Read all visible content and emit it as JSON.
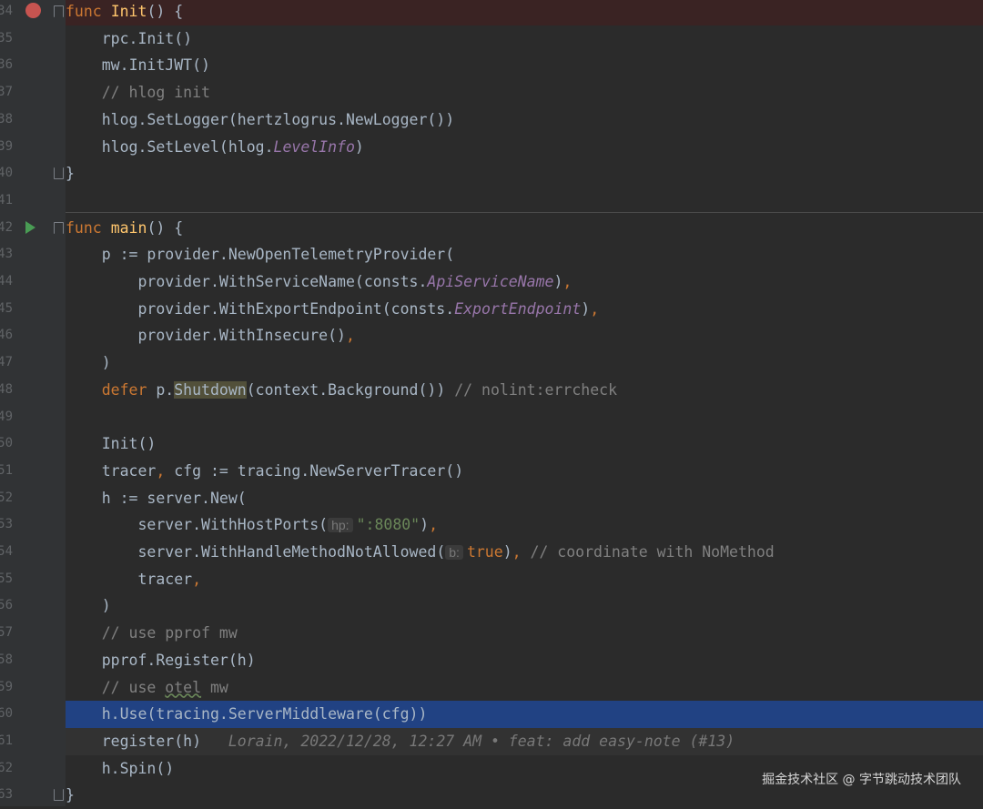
{
  "gutter": {
    "line_numbers": [
      "34",
      "35",
      "36",
      "37",
      "38",
      "39",
      "40",
      "41",
      "42",
      "43",
      "44",
      "45",
      "46",
      "47",
      "48",
      "49",
      "50",
      "51",
      "52",
      "53",
      "54",
      "55",
      "56",
      "57",
      "58",
      "59",
      "60",
      "61",
      "62",
      "63"
    ]
  },
  "code": {
    "l34": {
      "kw": "func",
      "name": "Init",
      "rest": "() {"
    },
    "l35": {
      "pkg": "rpc.",
      "fn": "Init",
      "rest": "()"
    },
    "l36": {
      "pkg": "mw.",
      "fn": "InitJWT",
      "rest": "()"
    },
    "l37": {
      "comment": "// hlog init"
    },
    "l38": {
      "pkg": "hlog.",
      "fn": "SetLogger",
      "rest1": "(hertzlogrus.",
      "fn2": "NewLogger",
      "rest2": "())"
    },
    "l39": {
      "pkg": "hlog.",
      "fn": "SetLevel",
      "rest1": "(hlog.",
      "const": "LevelInfo",
      "rest2": ")"
    },
    "l40": {
      "text": "}"
    },
    "l42": {
      "kw": "func",
      "name": "main",
      "rest": "() {"
    },
    "l43": {
      "pre": "p := provider.",
      "fn": "NewOpenTelemetryProvider",
      "rest": "("
    },
    "l44": {
      "pre": "provider.",
      "fn": "WithServiceName",
      "mid": "(consts.",
      "const": "ApiServiceName",
      "rest": ")",
      "comma": ","
    },
    "l45": {
      "pre": "provider.",
      "fn": "WithExportEndpoint",
      "mid": "(consts.",
      "const": "ExportEndpoint",
      "rest": ")",
      "comma": ","
    },
    "l46": {
      "pre": "provider.",
      "fn": "WithInsecure",
      "rest": "()",
      "comma": ","
    },
    "l47": {
      "text": ")"
    },
    "l48": {
      "kw": "defer",
      "pre": " p.",
      "fn": "Shutdown",
      "mid": "(context.",
      "fn2": "Background",
      "rest": "())",
      "comment": " // nolint:errcheck"
    },
    "l50": {
      "fn": "Init",
      "rest": "()"
    },
    "l51": {
      "pre": "tracer",
      "comma": ",",
      "mid": " cfg := tracing.",
      "fn": "NewServerTracer",
      "rest": "()"
    },
    "l52": {
      "pre": "h := server.",
      "fn": "New",
      "rest": "("
    },
    "l53": {
      "pre": "server.",
      "fn": "WithHostPorts",
      "rest": "(",
      "hint": "hp:",
      "str": "\":8080\"",
      "close": ")",
      "comma": ","
    },
    "l54": {
      "pre": "server.",
      "fn": "WithHandleMethodNotAllowed",
      "rest": "(",
      "hint": "b:",
      "kw": "true",
      "close": ")",
      "comma": ",",
      "comment": " // coordinate with NoMethod"
    },
    "l55": {
      "pre": "tracer",
      "comma": ","
    },
    "l56": {
      "text": ")"
    },
    "l57": {
      "comment": "// use pprof mw"
    },
    "l58": {
      "pre": "pprof.",
      "fn": "Register",
      "rest": "(h)"
    },
    "l59": {
      "comment_a": "// use ",
      "comment_b": "otel",
      "comment_c": " mw"
    },
    "l60": {
      "pre": "h.",
      "fn": "Use",
      "mid": "(tracing.",
      "fn2": "ServerMiddleware",
      "rest": "(cfg))"
    },
    "l61": {
      "fn": "register",
      "rest": "(h)",
      "blame": "Lorain, 2022/12/28, 12:27 AM • feat: add easy-note (#13)"
    },
    "l62": {
      "pre": "h.",
      "fn": "Spin",
      "rest": "()"
    },
    "l63": {
      "text": "}"
    }
  },
  "watermark": "掘金技术社区 @ 字节跳动技术团队",
  "colors": {
    "background": "#2b2b2b",
    "gutter": "#313335",
    "selection": "#214283",
    "breakpoint": "#c75450",
    "keyword": "#cc7832",
    "function": "#ffc66d",
    "comment": "#808080",
    "string": "#6a8759",
    "constant": "#9876aa"
  }
}
